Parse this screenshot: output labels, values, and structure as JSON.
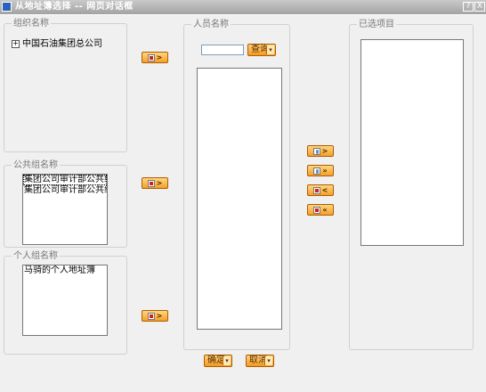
{
  "window": {
    "title": "从地址簿选择 -- 网页对话框",
    "help_label": "?",
    "close_label": "X"
  },
  "org_group": {
    "legend": "组织名称",
    "tree_root": "中国石油集团总公司",
    "tree_toggle": "+"
  },
  "public_group": {
    "legend": "公共组名称",
    "items": [
      "集团公司审计部公共组:",
      "集团公司审计部公共组:"
    ]
  },
  "personal_group": {
    "legend": "个人组名称",
    "items": [
      "马骑的个人地址簿"
    ]
  },
  "people_group": {
    "legend": "人员名称",
    "search_value": "",
    "search_button": "查询"
  },
  "selected_group": {
    "legend": "已选项目"
  },
  "move_buttons": {
    "single_right": ">",
    "all_right": "»",
    "single_left": "<",
    "all_left": "«"
  },
  "footer": {
    "ok_label": "确定",
    "cancel_label": "取消"
  }
}
